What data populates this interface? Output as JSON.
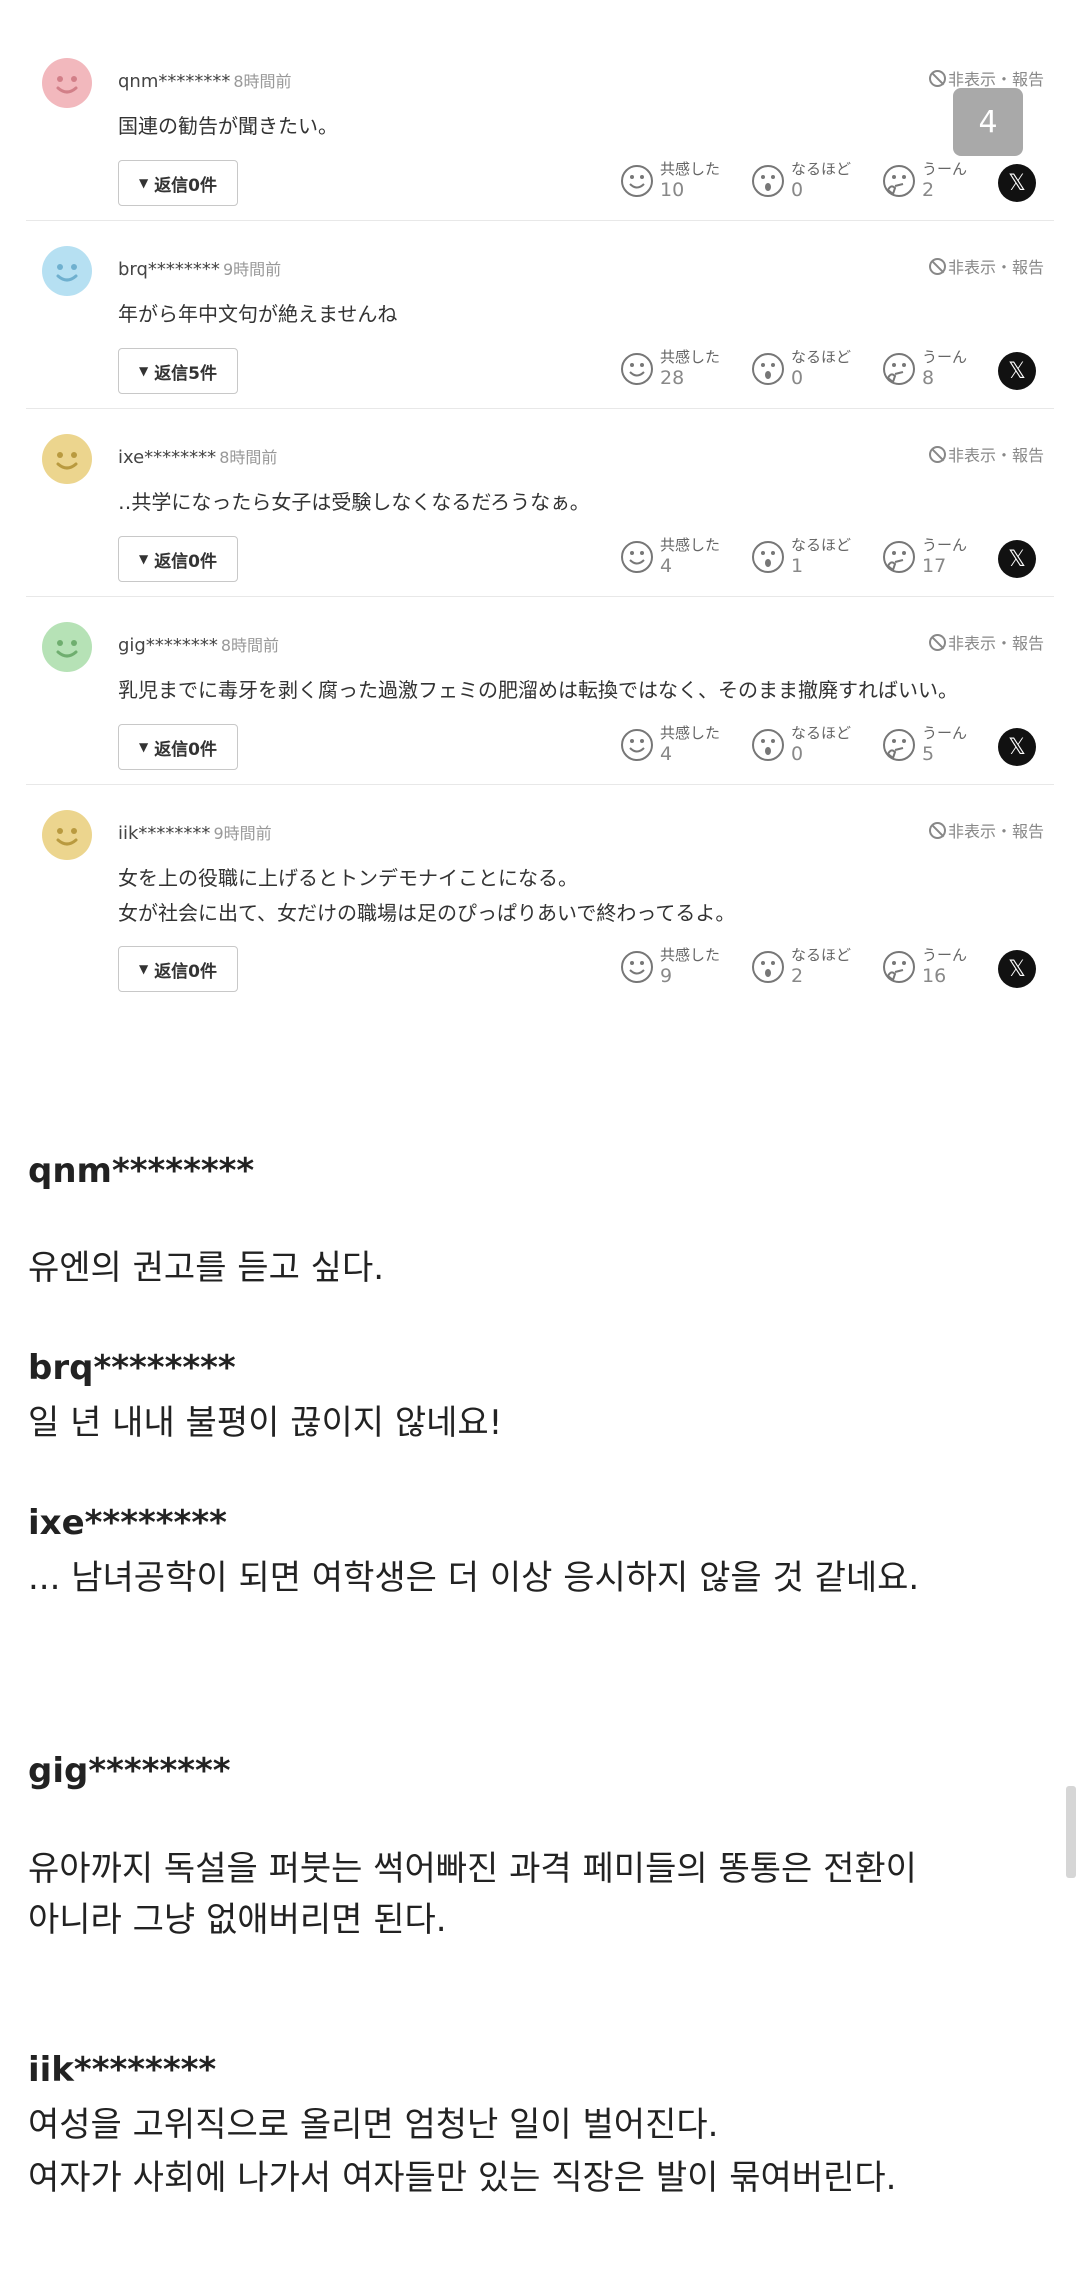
{
  "page_badge": "4",
  "hide_report_label": "非表示・報告",
  "reactions_labels": {
    "agree": "共感した",
    "indeed": "なるほど",
    "hmm": "うーん"
  },
  "x_glyph": "𝕏",
  "reply_arrow": "▼",
  "comments": [
    {
      "username": "qnm********",
      "time": "8時間前",
      "lines": [
        "国連の勧告が聞きたい。"
      ],
      "reply_label": "返信0件",
      "agree": "10",
      "indeed": "0",
      "hmm": "2",
      "avatar_color": "#f2b8bd"
    },
    {
      "username": "brq********",
      "time": "9時間前",
      "lines": [
        "年がら年中文句が絶えませんね"
      ],
      "reply_label": "返信5件",
      "agree": "28",
      "indeed": "0",
      "hmm": "8",
      "avatar_color": "#b6e0f2"
    },
    {
      "username": "ixe********",
      "time": "8時間前",
      "lines": [
        "‥共学になったら女子は受験しなくなるだろうなぁ。"
      ],
      "reply_label": "返信0件",
      "agree": "4",
      "indeed": "1",
      "hmm": "17",
      "avatar_color": "#ecd58e"
    },
    {
      "username": "gig********",
      "time": "8時間前",
      "lines": [
        "乳児までに毒牙を剥く腐った過激フェミの肥溜めは転換ではなく、そのまま撤廃すればいい。"
      ],
      "reply_label": "返信0件",
      "agree": "4",
      "indeed": "0",
      "hmm": "5",
      "avatar_color": "#b6e2b6"
    },
    {
      "username": "iik********",
      "time": "9時間前",
      "lines": [
        "女を上の役職に上げるとトンデモナイことになる。",
        "女が社会に出て、女だけの職場は足のぴっぱりあいで終わってるよ。"
      ],
      "reply_label": "返信0件",
      "agree": "9",
      "indeed": "2",
      "hmm": "16",
      "avatar_color": "#ecd58e"
    }
  ],
  "translations": [
    {
      "name": "qnm********",
      "lines": [
        "유엔의 권고를 듣고 싶다."
      ]
    },
    {
      "name": "brq********",
      "lines": [
        "일 년 내내 불평이 끊이지 않네요!"
      ]
    },
    {
      "name": "ixe********",
      "lines": [
        "... 남녀공학이 되면 여학생은 더 이상 응시하지 않을 것 같네요."
      ]
    },
    {
      "name": "gig********",
      "lines": [
        "유아까지 독설을 퍼붓는 썩어빠진 과격 페미들의 똥통은 전환이",
        "아니라 그냥 없애버리면 된다."
      ]
    },
    {
      "name": "iik********",
      "lines": [
        "여성을 고위직으로 올리면 엄청난 일이 벌어진다.",
        "여자가 사회에 나가서 여자들만 있는 직장은 발이 묶여버린다."
      ]
    }
  ]
}
